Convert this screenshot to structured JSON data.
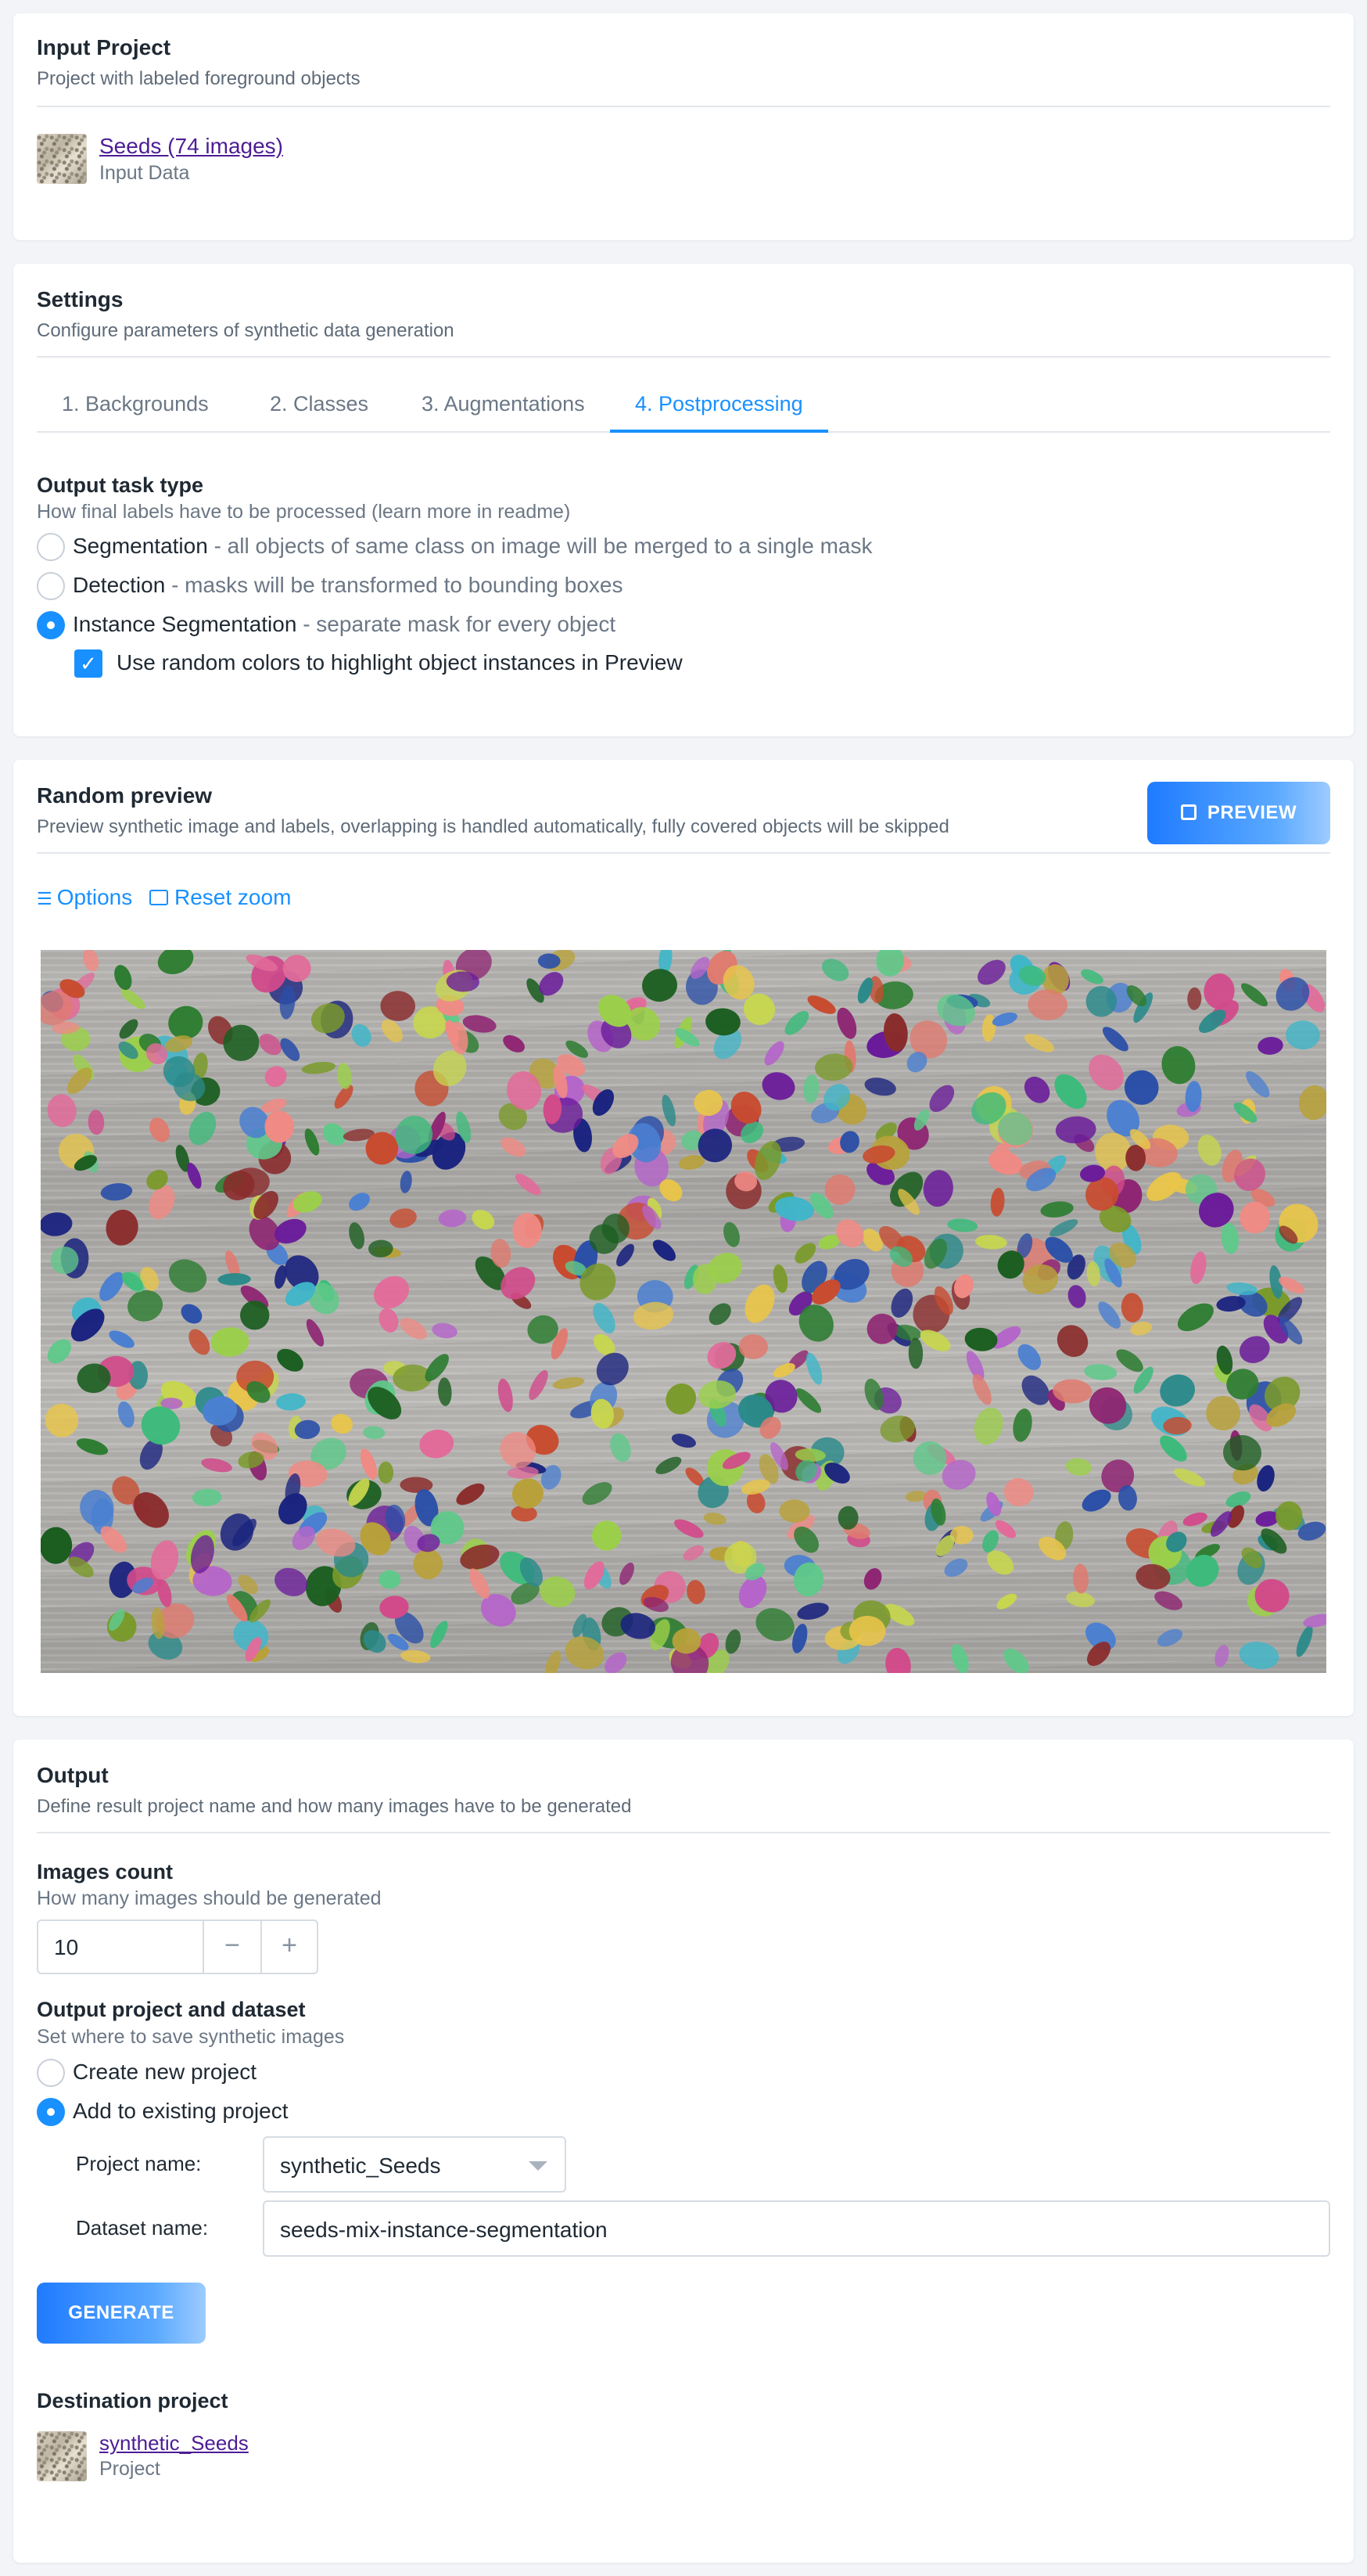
{
  "input_project": {
    "title": "Input Project",
    "subtitle": "Project with labeled foreground objects",
    "project_link": "Seeds (74 images)",
    "project_caption": "Input Data"
  },
  "settings": {
    "title": "Settings",
    "subtitle": "Configure parameters of synthetic data generation",
    "tabs": [
      {
        "label": "1. Backgrounds",
        "active": false
      },
      {
        "label": "2. Classes",
        "active": false
      },
      {
        "label": "3. Augmentations",
        "active": false
      },
      {
        "label": "4. Postprocessing",
        "active": true
      }
    ],
    "task_type_title": "Output task type",
    "task_type_subtitle": "How final labels have to be processed (learn more in readme)",
    "options": [
      {
        "name": "Segmentation",
        "desc": " - all objects of same class on image will be merged to a single mask",
        "selected": false
      },
      {
        "name": "Detection",
        "desc": " - masks will be transformed to bounding boxes",
        "selected": false
      },
      {
        "name": "Instance Segmentation",
        "desc": " - separate mask for every object",
        "selected": true
      }
    ],
    "random_colors_label": "Use random colors to highlight object instances in Preview",
    "random_colors_checked": true
  },
  "random_preview": {
    "title": "Random preview",
    "subtitle": "Preview synthetic image and labels, overlapping is handled automatically, fully covered objects will be skipped",
    "preview_button": "PREVIEW",
    "options_link": "Options",
    "reset_zoom_link": "Reset zoom"
  },
  "output": {
    "title": "Output",
    "subtitle": "Define result project name and how many images have to be generated",
    "images_count_title": "Images count",
    "images_count_subtitle": "How many images should be generated",
    "images_count_value": "10",
    "project_dataset_title": "Output project and dataset",
    "project_dataset_subtitle": "Set where to save synthetic images",
    "create_new_label": "Create new project",
    "add_existing_label": "Add to existing project",
    "add_existing_selected": true,
    "project_name_label": "Project name:",
    "project_name_value": "synthetic_Seeds",
    "dataset_name_label": "Dataset name:",
    "dataset_name_value": "seeds-mix-instance-segmentation",
    "generate_button": "GENERATE",
    "destination_title": "Destination project",
    "destination_link": "synthetic_Seeds",
    "destination_caption": "Project"
  },
  "colors": {
    "accent": "#1890ff",
    "link_purple": "#4c1d95",
    "seed_palette": [
      "#2e7d32",
      "#1b5e20",
      "#8e2472",
      "#6a1b9a",
      "#b565c9",
      "#e07a6f",
      "#f08a84",
      "#5fc98a",
      "#3dbb7b",
      "#9bcf4a",
      "#c7d64e",
      "#b8a13a",
      "#2a4fa8",
      "#1a237e",
      "#4a7fd1",
      "#2b8a8a",
      "#3fb6c9",
      "#8a2c2c",
      "#c84b2f",
      "#e26b9a",
      "#d14a8a",
      "#7a9a2a",
      "#e8c54a"
    ]
  },
  "icons": {
    "options": "sliders-icon",
    "reset_zoom": "image-frame-icon",
    "preview": "play-square-icon",
    "minus": "minus-icon",
    "plus": "plus-icon",
    "dropdown": "caret-down-icon",
    "check": "check-icon"
  }
}
